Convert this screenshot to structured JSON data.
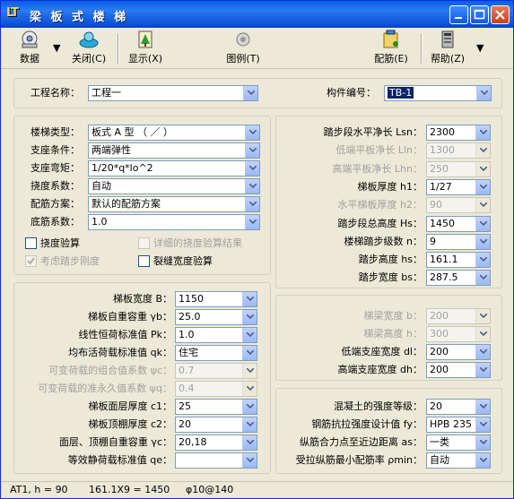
{
  "window": {
    "logo": "LT",
    "title": "梁 板 式 楼 梯",
    "buttons": {
      "minimize": "_",
      "maximize": "□",
      "close": "×"
    }
  },
  "toolbar": {
    "items": [
      {
        "label": "数据",
        "icon": "data-icon"
      },
      {
        "label": "关闭(C)",
        "icon": "close-doc-icon"
      },
      {
        "label": "显示(X)",
        "icon": "display-icon"
      },
      {
        "label": "图例(T)",
        "icon": "legend-icon"
      },
      {
        "label": "配筋(E)",
        "icon": "rebar-icon"
      },
      {
        "label": "帮助(Z)",
        "icon": "help-icon"
      }
    ]
  },
  "project": {
    "name_label": "工程名称：",
    "name_value": "工程一",
    "member_label": "构件编号：",
    "member_value": "TB-1"
  },
  "left_top": {
    "fields": [
      {
        "label": "楼梯类型：",
        "value": "板式 A 型 （ ／ ）"
      },
      {
        "label": "支座条件：",
        "value": "两端弹性"
      },
      {
        "label": "支座弯矩：",
        "value": "1/20*q*lo^2"
      },
      {
        "label": "挠度系数：",
        "value": "自动"
      },
      {
        "label": "配筋方案：",
        "value": "默认的配筋方案"
      },
      {
        "label": "底筋系数：",
        "value": "1.0"
      }
    ],
    "checks": [
      {
        "label": "挠度验算",
        "checked": false,
        "enabled": true
      },
      {
        "label": "详细的挠度验算结果",
        "checked": false,
        "enabled": false
      },
      {
        "label": "考虑踏步刚度",
        "checked": true,
        "enabled": false
      },
      {
        "label": "裂缝宽度验算",
        "checked": false,
        "enabled": true
      }
    ]
  },
  "right_top": {
    "fields": [
      {
        "label": "踏步段水平净长 Lsn：",
        "value": "2300",
        "enabled": true
      },
      {
        "label": "低端平板净长 Lln：",
        "value": "1300",
        "enabled": false
      },
      {
        "label": "高端平板净长 Lhn：",
        "value": "250",
        "enabled": false
      },
      {
        "label": "梯板厚度 h1：",
        "value": "1/27",
        "enabled": true
      },
      {
        "label": "水平梯板厚度 h2：",
        "value": "90",
        "enabled": false
      },
      {
        "label": "踏步段总高度 Hs：",
        "value": "1450",
        "enabled": true
      },
      {
        "label": "楼梯踏步级数 n：",
        "value": "9",
        "enabled": true
      },
      {
        "label": "踏步高度 hs：",
        "value": "161.1",
        "enabled": true
      },
      {
        "label": "踏步宽度 bs：",
        "value": "287.5",
        "enabled": true
      }
    ]
  },
  "left_bottom": {
    "fields": [
      {
        "label": "梯板宽度 B：",
        "value": "1150",
        "enabled": true
      },
      {
        "label": "梯板自重容重 γb：",
        "value": "25.0",
        "enabled": true
      },
      {
        "label": "线性恒荷标准值 Pk：",
        "value": "1.0",
        "enabled": true
      },
      {
        "label": "均布活荷载标准值 qk：",
        "value": "住宅",
        "enabled": true
      },
      {
        "label": "可变荷载的组合值系数 ψc：",
        "value": "0.7",
        "enabled": false
      },
      {
        "label": "可变荷载的准永久值系数 ψq：",
        "value": "0.4",
        "enabled": false
      },
      {
        "label": "梯板面层厚度 c1：",
        "value": "25",
        "enabled": true
      },
      {
        "label": "梯板顶棚厚度 c2：",
        "value": "20",
        "enabled": true
      },
      {
        "label": "面层、顶棚自重容重 γc：",
        "value": "20,18",
        "enabled": true
      },
      {
        "label": "等效静荷载标准值 qe：",
        "value": "",
        "enabled": true
      }
    ]
  },
  "right_mid": {
    "fields": [
      {
        "label": "梯梁宽度 b：",
        "value": "200",
        "enabled": false
      },
      {
        "label": "梯梁高度 h：",
        "value": "300",
        "enabled": false
      },
      {
        "label": "低端支座宽度 dl：",
        "value": "200",
        "enabled": true
      },
      {
        "label": "高端支座宽度 dh：",
        "value": "200",
        "enabled": true
      }
    ]
  },
  "right_bottom": {
    "fields": [
      {
        "label": "混凝土的强度等级：",
        "value": "20",
        "enabled": true
      },
      {
        "label": "钢筋抗拉强度设计值 fy：",
        "value": "HPB 235",
        "enabled": true
      },
      {
        "label": "纵筋合力点至近边距离 as：",
        "value": "一类",
        "enabled": true
      },
      {
        "label": "受拉纵筋最小配筋率 ρmin：",
        "value": "自动",
        "enabled": true
      }
    ]
  },
  "status": {
    "part1": "AT1, h = 90",
    "part2": "161.1X9 = 1450",
    "part3": "φ10@140"
  }
}
